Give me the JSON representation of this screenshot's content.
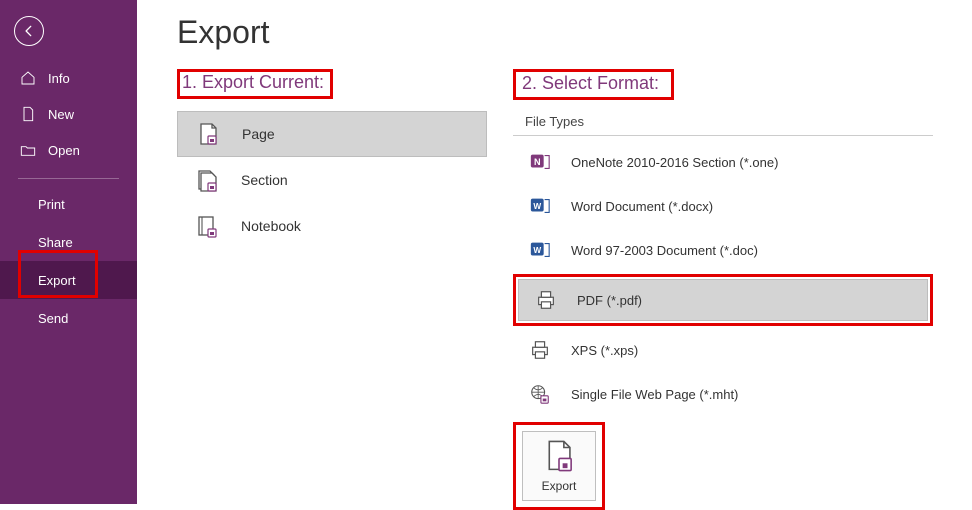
{
  "page_title": "Export",
  "sidebar": {
    "items": [
      {
        "label": "Info"
      },
      {
        "label": "New"
      },
      {
        "label": "Open"
      }
    ],
    "sub_items": [
      {
        "label": "Print"
      },
      {
        "label": "Share"
      },
      {
        "label": "Export"
      },
      {
        "label": "Send"
      }
    ]
  },
  "step1": {
    "header": "1. Export Current:",
    "options": [
      {
        "label": "Page"
      },
      {
        "label": "Section"
      },
      {
        "label": "Notebook"
      }
    ]
  },
  "step2": {
    "header": "2. Select Format:",
    "file_types_label": "File Types",
    "formats": [
      {
        "label": "OneNote 2010-2016 Section (*.one)"
      },
      {
        "label": "Word Document (*.docx)"
      },
      {
        "label": "Word 97-2003 Document (*.doc)"
      },
      {
        "label": "PDF (*.pdf)"
      },
      {
        "label": "XPS (*.xps)"
      },
      {
        "label": "Single File Web Page (*.mht)"
      }
    ]
  },
  "export_button_label": "Export"
}
